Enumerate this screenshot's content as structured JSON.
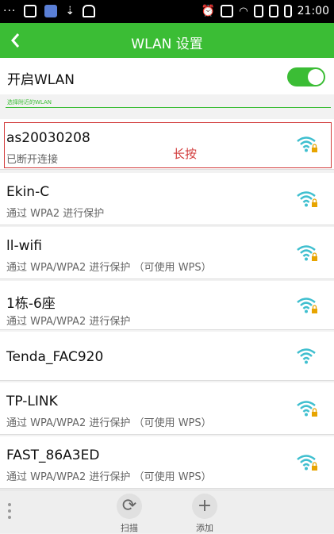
{
  "status_bar": {
    "dots": "···",
    "time": "21:00"
  },
  "header": {
    "back_icon": "back-chevron",
    "title": "WLAN 设置"
  },
  "wlan_toggle": {
    "label": "开启WLAN",
    "state": "on"
  },
  "section_label": "选择附近的WLAN",
  "networks": [
    {
      "name": "as20030208",
      "status": "已断开连接",
      "locked": true
    },
    {
      "name": "Ekin-C",
      "status": "通过 WPA2 进行保护",
      "locked": true
    },
    {
      "name": "ll-wifi",
      "status": "通过 WPA/WPA2 进行保护 （可使用 WPS）",
      "locked": true
    },
    {
      "name": "1栋-6座",
      "status": "通过 WPA/WPA2 进行保护",
      "locked": true
    },
    {
      "name": "Tenda_FAC920",
      "status": "",
      "locked": false
    },
    {
      "name": "TP-LINK",
      "status": "通过 WPA/WPA2 进行保护 （可使用 WPS）",
      "locked": true
    },
    {
      "name": "FAST_86A3ED",
      "status": "通过 WPA/WPA2 进行保护 （可使用 WPS）",
      "locked": true
    }
  ],
  "annotation": "长按",
  "bottom_bar": {
    "scan_label": "扫描",
    "add_label": "添加"
  },
  "colors": {
    "accent": "#3bbd35",
    "annotation": "#d23c3c",
    "wifi": "#3fbfcf",
    "lock": "#e7a400"
  }
}
